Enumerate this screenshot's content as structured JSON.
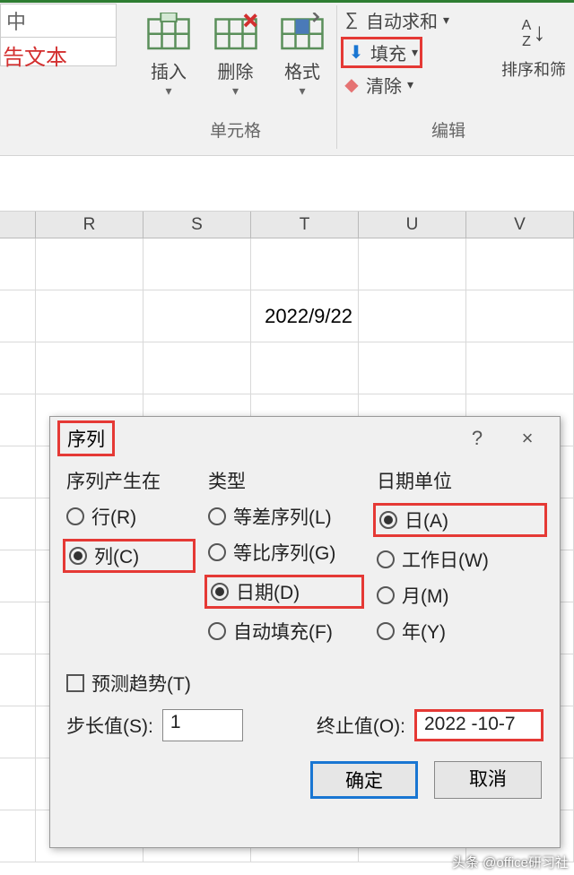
{
  "ribbon": {
    "namebox_line1": "中",
    "namebox_line2": "告文本",
    "insert": "插入",
    "delete": "删除",
    "format": "格式",
    "group_cells": "单元格",
    "autosum": "自动求和",
    "fill": "填充",
    "clear": "清除",
    "sort": "排序和筛",
    "group_edit": "编辑"
  },
  "grid": {
    "cols": [
      "R",
      "S",
      "T",
      "U",
      "V"
    ],
    "cell_t2": "2022/9/22"
  },
  "dialog": {
    "title": "序列",
    "help": "?",
    "close": "×",
    "section_in": "序列产生在",
    "radio_row": "行(R)",
    "radio_col": "列(C)",
    "section_type": "类型",
    "radio_linear": "等差序列(L)",
    "radio_growth": "等比序列(G)",
    "radio_date": "日期(D)",
    "radio_autofill": "自动填充(F)",
    "section_unit": "日期单位",
    "radio_day": "日(A)",
    "radio_weekday": "工作日(W)",
    "radio_month": "月(M)",
    "radio_year": "年(Y)",
    "checkbox_trend": "预测趋势(T)",
    "step_label": "步长值(S):",
    "step_value": "1",
    "stop_label": "终止值(O):",
    "stop_value": "2022 -10-7",
    "ok": "确定",
    "cancel": "取消"
  },
  "watermark": "头条 @office研习社"
}
